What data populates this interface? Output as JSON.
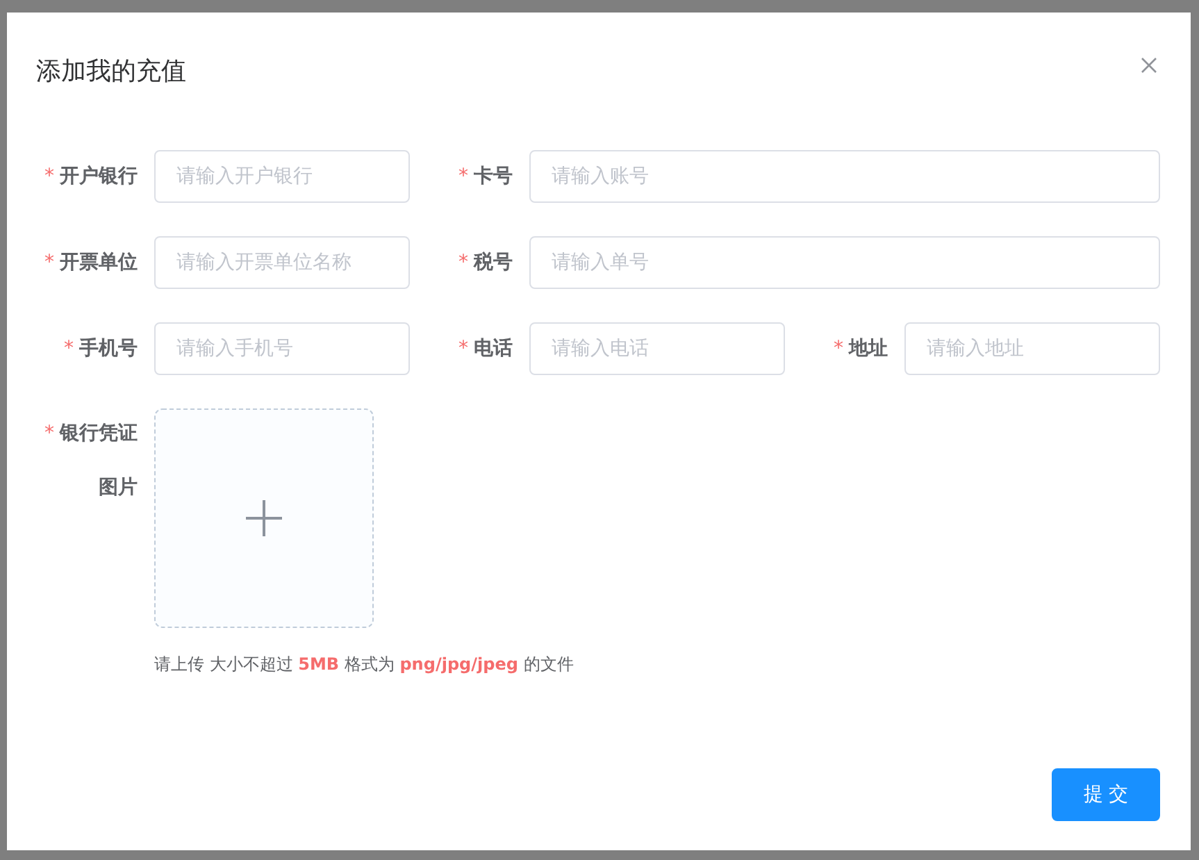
{
  "dialog": {
    "title": "添加我的充值"
  },
  "form": {
    "required_mark": "*",
    "rows": [
      [
        {
          "label": "开户银行",
          "placeholder": "请输入开户银行",
          "required": true
        },
        {
          "label": "卡号",
          "placeholder": "请输入账号",
          "required": true
        }
      ],
      [
        {
          "label": "开票单位",
          "placeholder": "请输入开票单位名称",
          "required": true
        },
        {
          "label": "税号",
          "placeholder": "请输入单号",
          "required": true
        }
      ],
      [
        {
          "label": "手机号",
          "placeholder": "请输入手机号",
          "required": true
        },
        {
          "label": "电话",
          "placeholder": "请输入电话",
          "required": true
        },
        {
          "label": "地址",
          "placeholder": "请输入地址",
          "required": true
        }
      ]
    ],
    "upload": {
      "label": "银行凭证图片",
      "required": true,
      "hint_parts": [
        {
          "text": "请上传 大小不超过 ",
          "highlight": false
        },
        {
          "text": "5MB",
          "highlight": true
        },
        {
          "text": " 格式为 ",
          "highlight": false
        },
        {
          "text": "png/jpg/jpeg",
          "highlight": true
        },
        {
          "text": " 的文件",
          "highlight": false
        }
      ]
    }
  },
  "buttons": [
    {
      "label": "提 交",
      "kind": "primary"
    }
  ]
}
